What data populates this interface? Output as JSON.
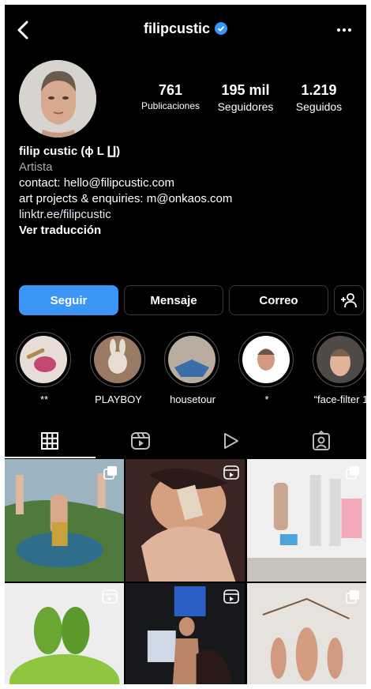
{
  "header": {
    "username": "filipcustic"
  },
  "stats": [
    {
      "value": "761",
      "label": "Publicaciones"
    },
    {
      "value": "195 mil",
      "label": "Seguidores"
    },
    {
      "value": "1.219",
      "label": "Seguidos"
    }
  ],
  "bio": {
    "name": "filip custic (ɸ L ∐)",
    "category": "Artista",
    "line1": "contact: hello@filipcustic.com",
    "line2": "art projects & enquiries: m@onkaos.com",
    "link": "linktr.ee/filipcustic",
    "translate": "Ver traducción"
  },
  "actions": {
    "follow": "Seguir",
    "message": "Mensaje",
    "email": "Correo"
  },
  "highlights": [
    {
      "label": "**"
    },
    {
      "label": "PLAYBOY"
    },
    {
      "label": "housetour"
    },
    {
      "label": "*"
    },
    {
      "label": "“face-filter 1"
    }
  ],
  "colors": {
    "background": "#000000",
    "accent": "#3b95f6",
    "verified": "#3b95f6"
  },
  "icons": [
    "back-icon",
    "verified-icon",
    "more-icon",
    "add-person-icon",
    "grid-icon",
    "reels-icon",
    "play-icon",
    "tagged-icon"
  ]
}
